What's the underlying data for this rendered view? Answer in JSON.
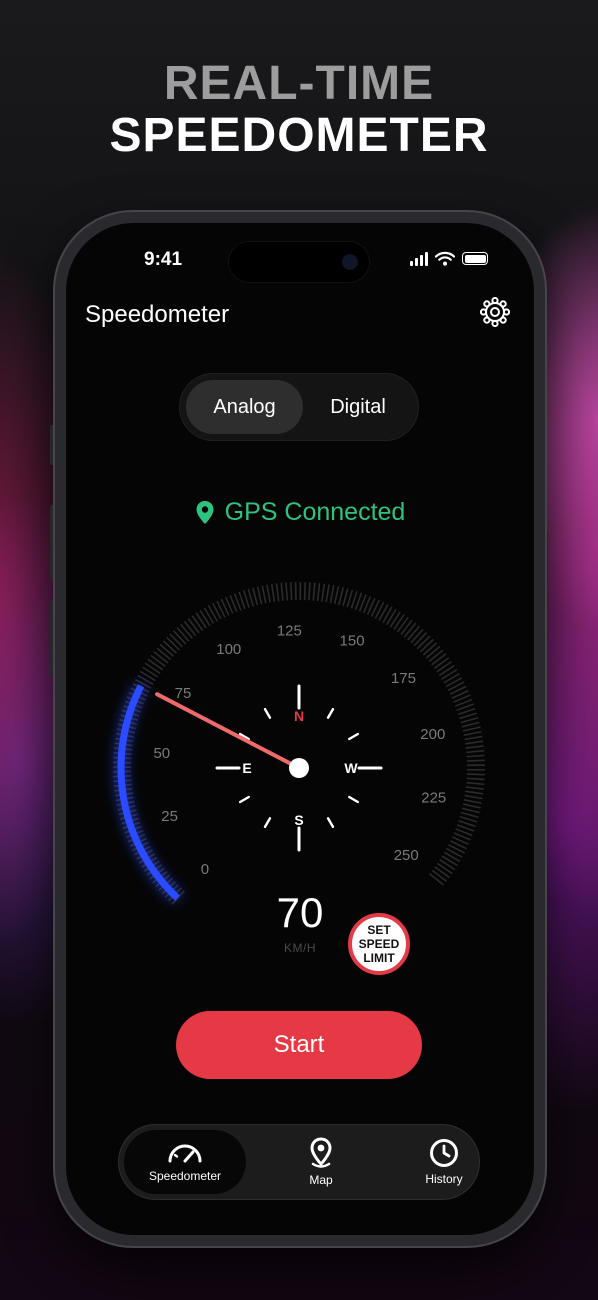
{
  "headline": {
    "line1": "REAL-TIME",
    "line2": "SPEEDOMETER"
  },
  "status_bar": {
    "time": "9:41"
  },
  "header": {
    "title": "Speedometer",
    "settings_icon": "gear-icon"
  },
  "mode_toggle": {
    "options": [
      "Analog",
      "Digital"
    ],
    "selected": "Analog"
  },
  "gps": {
    "status": "GPS Connected",
    "icon": "location-pin-icon",
    "color": "#2ec27e"
  },
  "gauge": {
    "scale_labels": [
      "0",
      "25",
      "50",
      "75",
      "100",
      "125",
      "150",
      "175",
      "200",
      "225",
      "250"
    ],
    "max": 250,
    "speed_value": 70,
    "compass": {
      "north": "N",
      "east": "E",
      "south": "S",
      "west": "W"
    },
    "arc_color": "#2a4cff",
    "needle_color": "#ef6b6b"
  },
  "speed_display": {
    "value": "70",
    "unit": "KM/H"
  },
  "speed_limit_badge": {
    "line1": "SET",
    "line2": "SPEED",
    "line3": "LIMIT"
  },
  "start_button": {
    "label": "Start",
    "color": "#e53945"
  },
  "tabbar": {
    "items": [
      {
        "label": "Speedometer",
        "icon": "gauge-icon",
        "active": true
      },
      {
        "label": "Map",
        "icon": "map-pin-icon",
        "active": false
      },
      {
        "label": "History",
        "icon": "clock-icon",
        "active": false
      }
    ]
  }
}
